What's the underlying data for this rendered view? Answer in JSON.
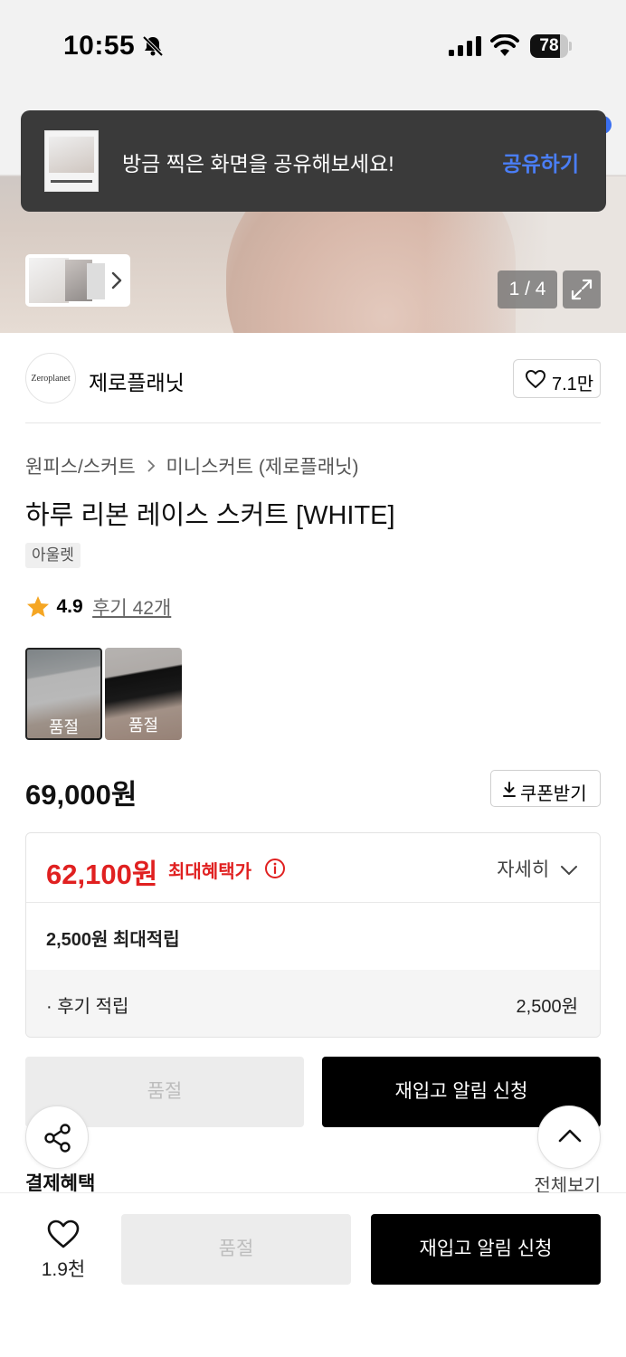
{
  "status_bar": {
    "time": "10:55",
    "battery": "78",
    "battery_level": 0.78
  },
  "toast": {
    "message": "방금 찍은 화면을 공유해보세요!",
    "action": "공유하기"
  },
  "gallery": {
    "counter": "1 / 4"
  },
  "brand": {
    "logo_text": "Zeroplanet",
    "name": "제로플래닛",
    "likes": "7.1만"
  },
  "breadcrumb": {
    "category": "원피스/스커트",
    "subcategory": "미니스커트 (제로플래닛)"
  },
  "product": {
    "title": "하루 리본 레이스 스커트 [WHITE]",
    "badge": "아울렛",
    "rating": "4.9",
    "reviews": "후기 42개",
    "options": [
      {
        "label": "품절"
      },
      {
        "label": "품절"
      }
    ],
    "original_price": "69,000원",
    "coupon_label": "쿠폰받기"
  },
  "benefit": {
    "sale_price": "62,100원",
    "max_benefit_label": "최대혜택가",
    "details_label": "자세히",
    "points_max": "2,500원 최대적립",
    "points_row_label": "· 후기 적립",
    "points_row_value": "2,500원"
  },
  "actions": {
    "soldout": "품절",
    "restock": "재입고 알림 신청"
  },
  "payment": {
    "heading": "결제혜택",
    "view_all": "전체보기"
  },
  "bottom_bar": {
    "wishlist_count": "1.9천",
    "soldout": "품절",
    "restock": "재입고 알림 신청"
  },
  "colors": {
    "accent_red": "#e02020",
    "toast_link": "#4a7ef7",
    "rating_star": "#f5a623"
  }
}
